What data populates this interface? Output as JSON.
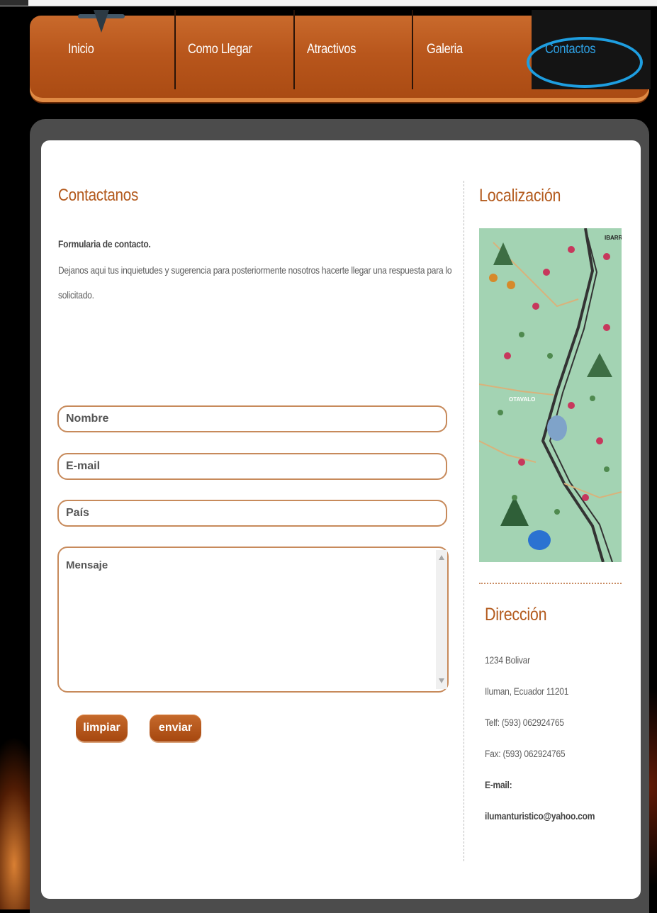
{
  "nav": {
    "items": [
      {
        "label": "Inicio"
      },
      {
        "label": "Como Llegar"
      },
      {
        "label": "Atractivos"
      },
      {
        "label": "Galeria"
      },
      {
        "label": "Contactos",
        "active": true
      }
    ],
    "active_color": "#2ea2e6",
    "highlight_color": "#1e9ee0"
  },
  "contact": {
    "title": "Contactanos",
    "form_heading": "Formularia de contacto.",
    "description_line1": "Dejanos aqui tus inquietudes y sugerencia para posteriormente nosotros hacerte llegar una respuesta para lo",
    "description_line2": "solicitado.",
    "fields": {
      "name": "Nombre",
      "email": "E-mail",
      "country": "País",
      "message": "Mensaje"
    },
    "buttons": {
      "clear": "limpiar",
      "send": "enviar"
    }
  },
  "sidebar": {
    "location_title": "Localización",
    "map_labels": {
      "ibarra": "IBARRA",
      "otavalo": "OTAVALO"
    },
    "address_title": "Dirección",
    "address_line1": "1234 Bolivar",
    "address_line2": "Iluman, Ecuador 11201",
    "phone": "Telf: (593) 062924765",
    "fax": "Fax: (593) 062924765",
    "email_label": "E-mail:",
    "email": "ilumanturistico@yahoo.com"
  },
  "colors": {
    "accent": "#b35a1d",
    "nav_orange": "#b8561c",
    "frame_gray": "#4c4c4c"
  }
}
